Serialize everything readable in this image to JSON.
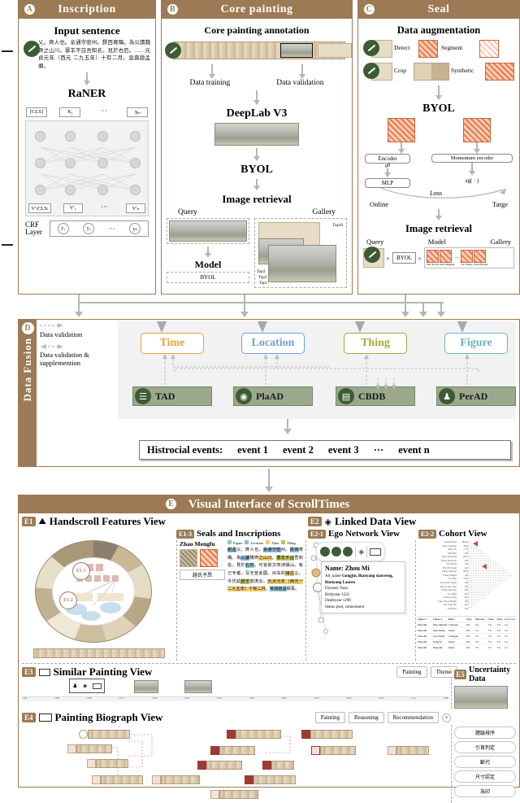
{
  "panels": {
    "a": {
      "tag": "A",
      "title": "Inscription",
      "section_title": "Input sentence",
      "sample_text": "父。齊人也。余通守密州。膠西寒隅。為公讀魏齊之山川。罪羊不註吾知名。見於右匹。……元貞元年（西元 二九五年）十有二月。吳興趙孟頫。",
      "model": "RaNER",
      "tokens": [
        "[CLS]",
        "X₁",
        "···",
        "Xₙ"
      ],
      "outputs": [
        "V'₍CLS₎",
        "V'₁",
        "···",
        "V'ₙ"
      ],
      "crf_label": "CRF\nLayer",
      "crf_line1": "CRF",
      "crf_line2": "Layer",
      "crf_nodes": [
        "y₁",
        "y₂",
        "···",
        "yₙ"
      ]
    },
    "b": {
      "tag": "B",
      "title": "Core painting",
      "section_title": "Core painting annotation",
      "training": "Data training",
      "validation": "Data validation",
      "model1": "DeepLab V3",
      "model2": "BYOL",
      "retrieval": "Image retrieval",
      "query": "Query",
      "gallery": "Gallery",
      "model_label": "Model",
      "model_box": "BYOL",
      "gallery_ranks": [
        "Top1",
        "Top2",
        "Top3",
        "Top10"
      ]
    },
    "c": {
      "tag": "C",
      "title": "Seal",
      "section_title": "Data augmentation",
      "steps": [
        "Detect",
        "Segment",
        "Crop",
        "Synthetic"
      ],
      "model": "BYOL",
      "encoder": "Encoder",
      "encoder_sub": "qθ",
      "mlp": "MLP",
      "momentum_encoder": "Momentum encoder",
      "sg": "sg( · )",
      "loss": "Loss",
      "online": "Online",
      "target": "Targe",
      "retrieval": "Image retrieval",
      "query": "Query",
      "model_label": "Model",
      "model_box": "BYOL",
      "gallery": "Gallery",
      "gallery_items": [
        "Top1",
        "Top2",
        "Top3",
        "Top10"
      ],
      "gallery_subs": [
        "Pan Xiaofu",
        "Zhu Mingzhi",
        "Gu Cheng",
        "Chai Baojun"
      ]
    },
    "d": {
      "tag": "D",
      "side_title": "Data Fusion",
      "legend1": "Data validation",
      "legend2": "Data validation & supplemention",
      "entities": [
        {
          "label": "Time",
          "color": "#e8a33d"
        },
        {
          "label": "Location",
          "color": "#6f9fd8"
        },
        {
          "label": "Thing",
          "color": "#a8a83c"
        },
        {
          "label": "Figure",
          "color": "#6cb2bd"
        }
      ],
      "databases": [
        {
          "label": "TAD",
          "icon": "list-icon"
        },
        {
          "label": "PlaAD",
          "icon": "pin-icon"
        },
        {
          "label": "CBDB",
          "icon": "book-icon"
        },
        {
          "label": "PerAD",
          "icon": "person-icon"
        }
      ],
      "events_title": "Histrocial events:",
      "events": [
        "event 1",
        "event 2",
        "event 3",
        "···",
        "event n"
      ]
    },
    "e": {
      "tag": "E",
      "title": "Visual Interface of ScrollTimes",
      "e1": {
        "tag": "E1",
        "title": "Handscroll Features View",
        "icon": "mountain-icon",
        "inner_tags": [
          "E1-1",
          "E1-2"
        ]
      },
      "e13": {
        "tag": "E1-3",
        "title": "Seals and Inscriptions",
        "person": "Zhao Mengfu",
        "seal_caption": "趙氏子昂",
        "legend": [
          {
            "label": "Figure",
            "color": "#8fc7d8"
          },
          {
            "label": "Location",
            "color": "#8fb9e0"
          },
          {
            "label": "Time",
            "color": "#f2cf72"
          },
          {
            "label": "Thing",
            "color": "#bfbf5e"
          }
        ]
      },
      "e2": {
        "tag": "E2",
        "title": "Linked Data View",
        "icon": "link-icon"
      },
      "e21": {
        "tag": "E2-1",
        "title": "Ego Network View",
        "toolbar_icons": [
          "brush-icon",
          "seal-icon",
          "stamp-icon",
          "link-icon",
          "scroll-icon"
        ],
        "card": {
          "name_label": "Name:",
          "name_value": "Zhou Mi",
          "rows": [
            {
              "k": "Alt_name",
              "v": "Gongjin, Bianyang xiaoweng, Bianyang Laoren"
            },
            {
              "k": "Dynasty",
              "v": "Yuan"
            },
            {
              "k": "Birthyear",
              "v": "1232"
            },
            {
              "k": "Deathyear",
              "v": "1298"
            },
            {
              "k": "Status",
              "v": "poet, connoisseur"
            }
          ]
        }
      },
      "e22": {
        "tag": "E2-2",
        "title": "Cohort View",
        "people": [
          "Kuang Bian",
          "Zhao Mengfu",
          "Yang Jie",
          "Shen Bo",
          "Zhou Jingtang",
          "Wang Nanshan",
          "Jiao Bang",
          "Wu Zhi Kang",
          "Deng Zhilong",
          "Liang Qingbi",
          "Fei Bin",
          "Ali Chun Weian",
          "Zhao Lian Guqi",
          "Wang Qiu Jiao",
          "Gu Qing",
          "Zhang Liang",
          "Lian Zhou Mingli",
          "Wu Jing Yun",
          "Guofuxu"
        ],
        "values": [
          "955.0",
          "42.0",
          "5.5",
          "6.0",
          "83.5",
          "6.0",
          "7.0",
          "6.0",
          "83.5",
          "4.0",
          "75.0",
          "6.0",
          "6.0",
          "6.0",
          "6.0",
          "6.0",
          "6.0",
          "6.0",
          "6.0"
        ],
        "table_headers": [
          "Figure 1",
          "Figure 2",
          "Relay",
          "Type",
          "Measure",
          "Node",
          "Mod",
          "Reference"
        ],
        "table_rows": [
          [
            "Zhou Mi",
            "Zhao Mengfu",
            "colleague",
            "0.8",
            "7.0",
            "7.0",
            "7.0",
            "Ref"
          ],
          [
            "Zhou Mi",
            "Xian Yushu",
            "friend",
            "0.8",
            "7.0",
            "7.0",
            "7.0",
            "Ref"
          ],
          [
            "Zhou Mi",
            "Guo Tianxi",
            "colleague",
            "0.8",
            "7.0",
            "7.0",
            "7.0",
            "Ref"
          ],
          [
            "Zhou Mi",
            "Wang Yi",
            "friend",
            "0.8",
            "7.0",
            "7.0",
            "7.0",
            "Ref"
          ],
          [
            "Zhou Mi",
            "Deng Mu",
            "friend",
            "0.8",
            "7.0",
            "7.0",
            "7.0",
            "Ref"
          ]
        ]
      },
      "e3": {
        "tag": "E3",
        "title": "Similar Painting View",
        "icon": "scroll-icon",
        "buttons": [
          "Painting",
          "Theme"
        ],
        "axis_ticks": [
          "1120",
          "1200",
          "1280",
          "1360",
          "1440",
          "1520",
          "1600",
          "1680",
          "1760",
          "1840",
          "1920",
          "2000"
        ],
        "axis_marks": [
          "Ming",
          "Qing"
        ]
      },
      "e4": {
        "tag": "E4",
        "title": "Painting Biograph View",
        "icon": "scroll-icon",
        "buttons": [
          "Painting",
          "Reasoning",
          "Recommendation",
          "+"
        ]
      },
      "e5": {
        "tag": "E5",
        "title": "Uncertainty Data",
        "buttons": [
          "題跋排序",
          "引首判定",
          "斷代",
          "尺寸認定",
          "為印"
        ]
      }
    }
  }
}
